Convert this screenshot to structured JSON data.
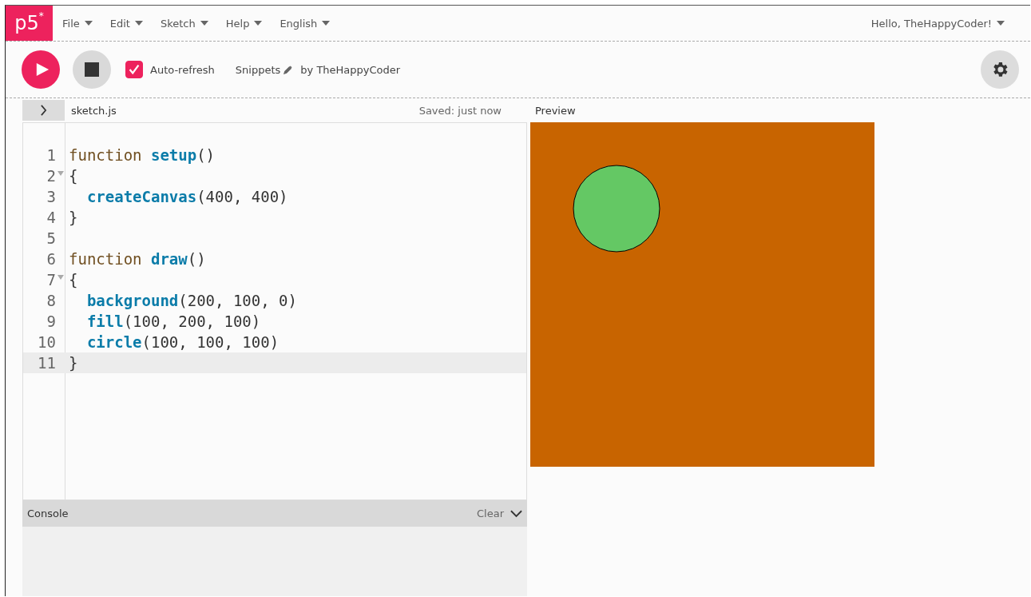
{
  "logo": {
    "text": "p5",
    "mark": "*"
  },
  "menu": [
    {
      "label": "File"
    },
    {
      "label": "Edit"
    },
    {
      "label": "Sketch"
    },
    {
      "label": "Help"
    },
    {
      "label": "English"
    }
  ],
  "user_menu": {
    "label": "Hello, TheHappyCoder!"
  },
  "toolbar": {
    "auto_refresh": {
      "label": "Auto-refresh",
      "checked": true
    },
    "sketch_name": "Snippets",
    "author": "by TheHappyCoder"
  },
  "editor": {
    "file_name": "sketch.js",
    "save_status": "Saved: just now",
    "lines": [
      {
        "number": "1",
        "foldable": false,
        "active": false,
        "tokens": [
          {
            "kind": "keyword",
            "text": "function "
          },
          {
            "kind": "name",
            "text": "setup"
          },
          {
            "kind": "plain",
            "text": "()"
          }
        ]
      },
      {
        "number": "2",
        "foldable": true,
        "active": false,
        "tokens": [
          {
            "kind": "plain",
            "text": "{"
          }
        ]
      },
      {
        "number": "3",
        "foldable": false,
        "active": false,
        "tokens": [
          {
            "kind": "name",
            "text": "  createCanvas"
          },
          {
            "kind": "plain",
            "text": "(400, 400)"
          }
        ]
      },
      {
        "number": "4",
        "foldable": false,
        "active": false,
        "tokens": [
          {
            "kind": "plain",
            "text": "}"
          }
        ]
      },
      {
        "number": "5",
        "foldable": false,
        "active": false
      },
      {
        "number": "6",
        "foldable": false,
        "active": false,
        "tokens": [
          {
            "kind": "keyword",
            "text": "function "
          },
          {
            "kind": "name",
            "text": "draw"
          },
          {
            "kind": "plain",
            "text": "()"
          }
        ]
      },
      {
        "number": "7",
        "foldable": true,
        "active": false,
        "tokens": [
          {
            "kind": "plain",
            "text": "{"
          }
        ]
      },
      {
        "number": "8",
        "foldable": false,
        "active": false,
        "tokens": [
          {
            "kind": "name",
            "text": "  background"
          },
          {
            "kind": "plain",
            "text": "(200, 100, 0)"
          }
        ]
      },
      {
        "number": "9",
        "foldable": false,
        "active": false,
        "tokens": [
          {
            "kind": "name",
            "text": "  fill"
          },
          {
            "kind": "plain",
            "text": "(100, 200, 100)"
          }
        ]
      },
      {
        "number": "10",
        "foldable": false,
        "active": false,
        "tokens": [
          {
            "kind": "name",
            "text": "  circle"
          },
          {
            "kind": "plain",
            "text": "(100, 100, 100)"
          }
        ]
      },
      {
        "number": "11",
        "foldable": false,
        "active": true,
        "tokens": [
          {
            "kind": "plain",
            "text": "}"
          }
        ]
      }
    ]
  },
  "console": {
    "title": "Console",
    "clear": "Clear"
  },
  "preview": {
    "title": "Preview"
  }
}
